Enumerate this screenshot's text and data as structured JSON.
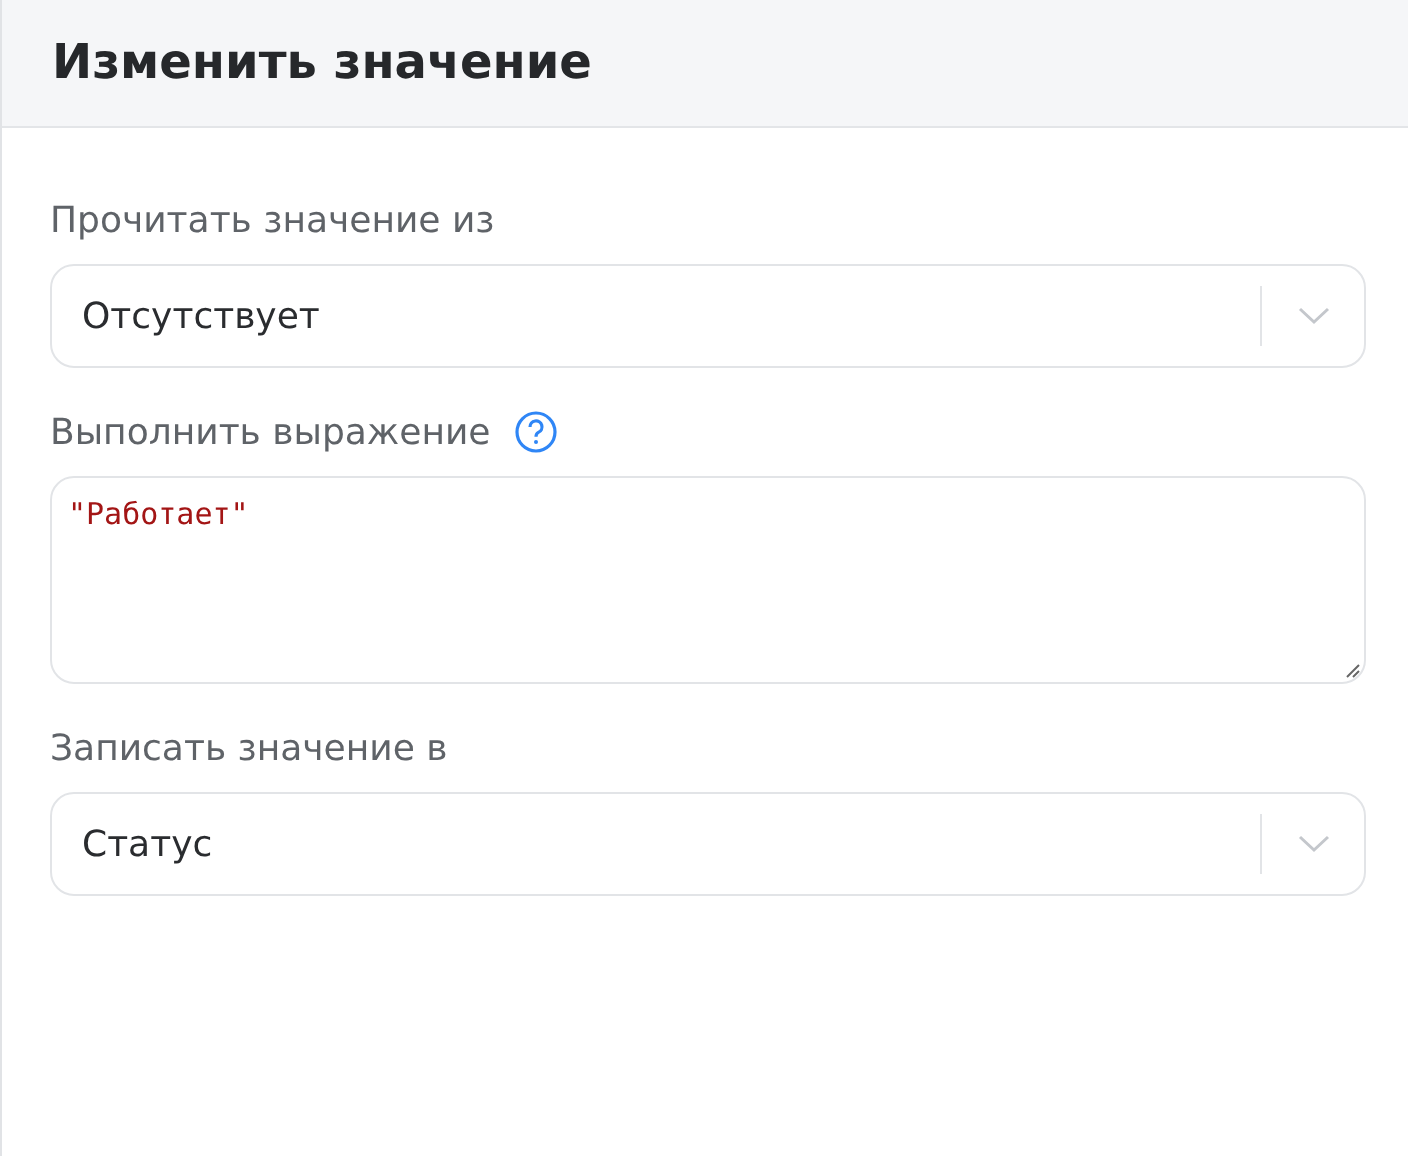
{
  "header": {
    "title": "Изменить значение"
  },
  "fields": [
    {
      "kind": "select",
      "label": "Прочитать значение из",
      "value": "Отсутствует",
      "help": false
    },
    {
      "kind": "expression",
      "label": "Выполнить выражение",
      "value": "\"Работает\"",
      "help": true
    },
    {
      "kind": "select",
      "label": "Записать значение в",
      "value": "Статус",
      "help": false
    }
  ]
}
